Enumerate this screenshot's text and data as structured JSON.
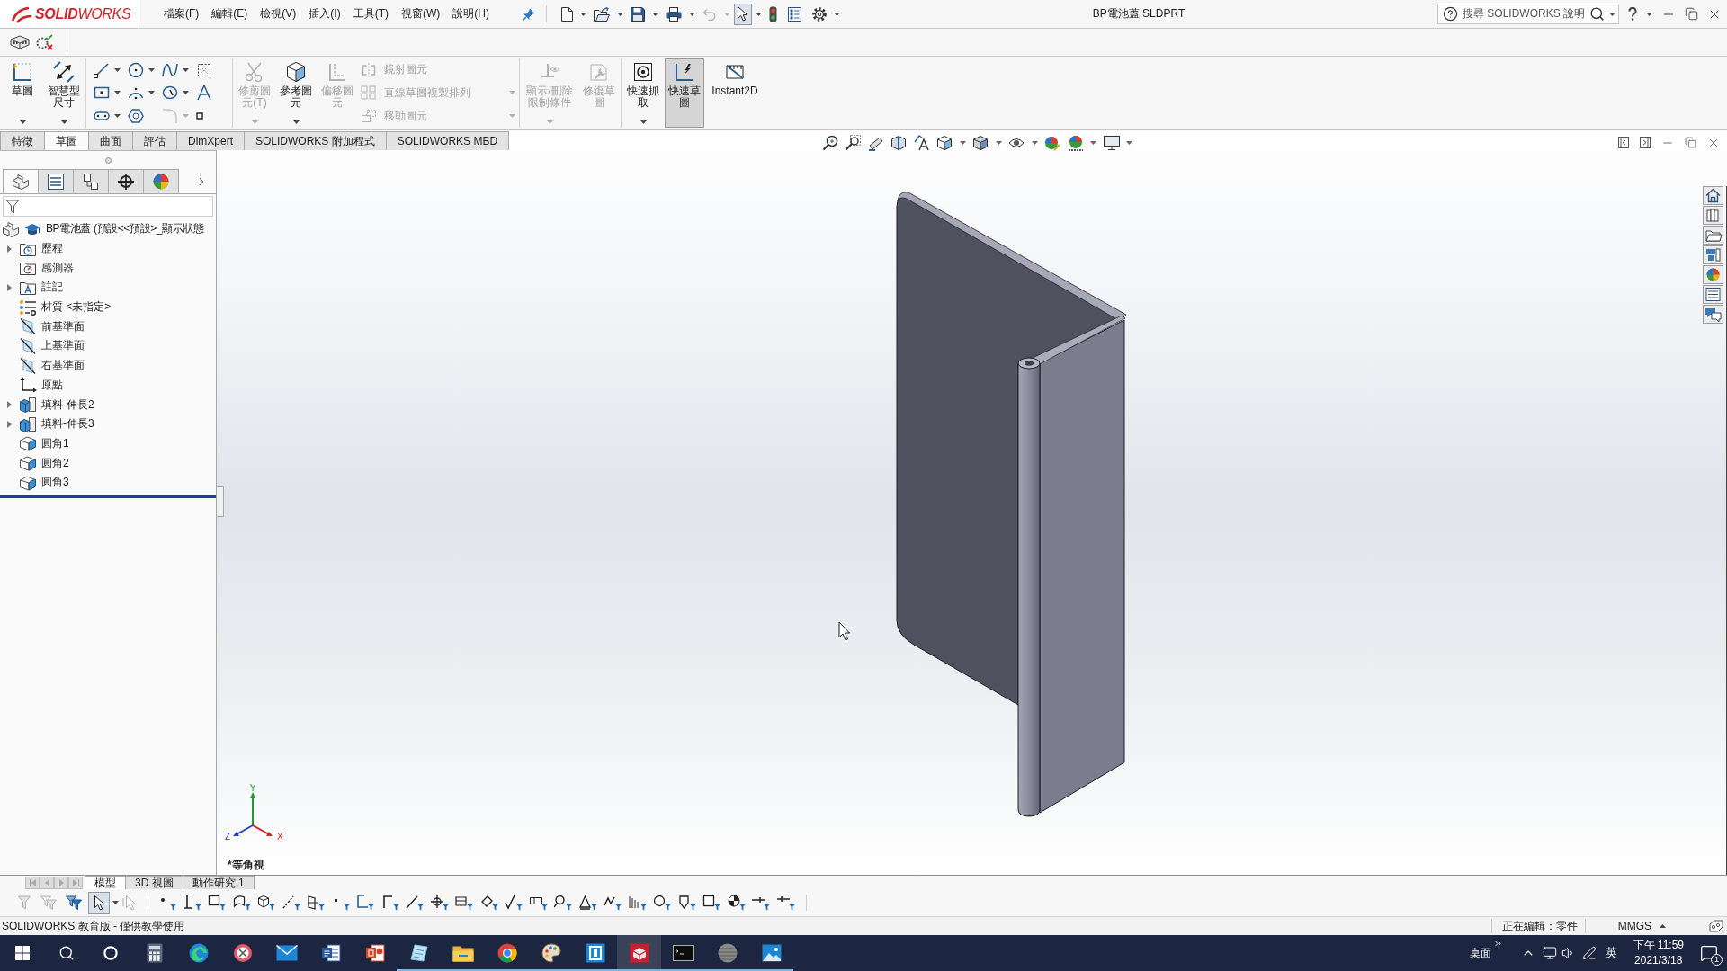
{
  "app": {
    "logo": "**SOLID**WORKS",
    "menus": [
      "檔案(F)",
      "編輯(E)",
      "檢視(V)",
      "插入(I)",
      "工具(T)",
      "視窗(W)",
      "說明(H)"
    ],
    "title": "BP電池蓋.SLDPRT",
    "search": {
      "placeholder": "搜尋 SOLIDWORKS 說明"
    }
  },
  "quick_tools": [
    {
      "disabled": false,
      "active": false
    },
    {
      "disabled": false,
      "active": false
    },
    {
      "disabled": false,
      "active": false
    },
    {
      "disabled": false,
      "active": false
    },
    {
      "disabled": true,
      "active": false
    },
    {
      "disabled": false,
      "active": true
    },
    {
      "disabled": false,
      "active": false
    },
    {
      "disabled": false,
      "active": false
    },
    {
      "disabled": false,
      "active": false
    }
  ],
  "ribbon": {
    "groups": [
      {
        "items": [
          {
            "kind": "big",
            "label": "草圖",
            "disabled": false,
            "selected": false
          },
          {
            "kind": "big",
            "label": "智慧型尺寸",
            "disabled": false,
            "selected": false
          }
        ]
      },
      {
        "items": [
          {
            "kind": "tools",
            "tools": [
              {
                "disabled": false
              },
              {
                "disabled": false
              },
              {
                "disabled": false
              },
              {
                "disabled": false
              },
              {
                "disabled": false
              },
              {
                "disabled": false
              },
              {
                "disabled": false
              },
              {
                "disabled": false
              },
              {
                "disabled": false
              },
              {
                "disabled": false
              },
              {
                "disabled": true
              },
              {
                "disabled": false
              }
            ]
          }
        ]
      },
      {
        "items": [
          {
            "kind": "big",
            "label": "修剪圖元(T)",
            "disabled": true,
            "selected": false
          },
          {
            "kind": "big",
            "label": "參考圖元",
            "disabled": false,
            "selected": false
          },
          {
            "kind": "big",
            "label": "偏移圖元",
            "disabled": true,
            "selected": false
          },
          {
            "kind": "rows",
            "rows": [
              {
                "label": "鏡射圖元",
                "disabled": true
              },
              {
                "label": "直線草圖複製排列",
                "disabled": true
              },
              {
                "label": "移動圖元",
                "disabled": true
              }
            ]
          }
        ]
      },
      {
        "items": [
          {
            "kind": "big",
            "label": "顯示/刪除限制條件",
            "disabled": true,
            "selected": false
          },
          {
            "kind": "big",
            "label": "修復草圖",
            "disabled": true,
            "selected": false
          }
        ]
      },
      {
        "items": [
          {
            "kind": "big",
            "label": "快速抓取",
            "disabled": false,
            "selected": false
          },
          {
            "kind": "big",
            "label": "快速草圖",
            "disabled": false,
            "selected": true
          },
          {
            "kind": "big",
            "label": "Instant2D",
            "disabled": false,
            "selected": false
          }
        ]
      }
    ]
  },
  "ribbon_tabs": [
    {
      "label": "特徵",
      "selected": false
    },
    {
      "label": "草圖",
      "selected": true
    },
    {
      "label": "曲面",
      "selected": false
    },
    {
      "label": "評估",
      "selected": false
    },
    {
      "label": "DimXpert",
      "selected": false
    },
    {
      "label": "SOLIDWORKS 附加程式",
      "selected": false
    },
    {
      "label": "SOLIDWORKS MBD",
      "selected": false
    }
  ],
  "feature_manager": {
    "tabs": [
      {
        "selected": true
      },
      {
        "selected": false
      },
      {
        "selected": false
      },
      {
        "selected": false
      },
      {
        "selected": false
      }
    ],
    "root": "BP電池蓋 (預設<<預設>_顯示狀態",
    "items": [
      {
        "kind": "history",
        "label": "歷程",
        "expandable": true
      },
      {
        "kind": "sensors",
        "label": "感測器",
        "expandable": false
      },
      {
        "kind": "annotations",
        "label": "註記",
        "expandable": true
      },
      {
        "kind": "material",
        "label": "材質 <未指定>",
        "expandable": false
      },
      {
        "kind": "plane",
        "label": "前基準面",
        "expandable": false
      },
      {
        "kind": "plane",
        "label": "上基準面",
        "expandable": false
      },
      {
        "kind": "plane",
        "label": "右基準面",
        "expandable": false
      },
      {
        "kind": "origin",
        "label": "原點",
        "expandable": false
      },
      {
        "kind": "extrude",
        "label": "填料-伸長2",
        "expandable": true
      },
      {
        "kind": "extrude",
        "label": "填料-伸長3",
        "expandable": true
      },
      {
        "kind": "fillet",
        "label": "圓角1",
        "expandable": false
      },
      {
        "kind": "fillet",
        "label": "圓角2",
        "expandable": false
      },
      {
        "kind": "fillet",
        "label": "圓角3",
        "expandable": false
      }
    ]
  },
  "viewport": {
    "view_name": "*等角視",
    "triad": {
      "x": "X",
      "y": "Y",
      "z": "Z"
    }
  },
  "bottom_tabs": {
    "scroll_buttons": [
      {
        "disabled": true
      },
      {
        "disabled": true
      },
      {
        "disabled": true
      },
      {
        "disabled": true
      }
    ],
    "tabs": [
      {
        "label": "模型",
        "selected": true
      },
      {
        "label": "3D 視圖",
        "selected": false
      },
      {
        "label": "動作研究 1",
        "selected": false
      }
    ]
  },
  "select_tools": [
    {
      "disabled": true,
      "active": false
    },
    {
      "disabled": true,
      "active": false
    },
    {
      "disabled": false,
      "active": false
    },
    {
      "disabled": false,
      "active": true
    },
    {
      "disabled": true,
      "active": false
    }
  ],
  "status_bar": {
    "message": "SOLIDWORKS 教育版 - 僅供教學使用",
    "editing": "正在編輯：零件",
    "units": "MMGS"
  },
  "taskbar": {
    "apps": [
      {
        "running": false,
        "active": false
      },
      {
        "running": false,
        "active": false
      },
      {
        "running": false,
        "active": false
      },
      {
        "running": false,
        "active": false
      },
      {
        "running": false,
        "active": false
      },
      {
        "running": false,
        "active": false
      },
      {
        "running": true,
        "active": false
      },
      {
        "running": true,
        "active": false
      },
      {
        "running": true,
        "active": false
      },
      {
        "running": true,
        "active": false
      },
      {
        "running": true,
        "active": false
      },
      {
        "running": true,
        "active": true
      },
      {
        "running": true,
        "active": false
      },
      {
        "running": true,
        "active": false
      },
      {
        "running": true,
        "active": false
      }
    ],
    "tray": {
      "desktop": "桌面",
      "ime": "英",
      "time": "下午 11:59",
      "date": "2021/3/18",
      "notifications": "1"
    }
  }
}
